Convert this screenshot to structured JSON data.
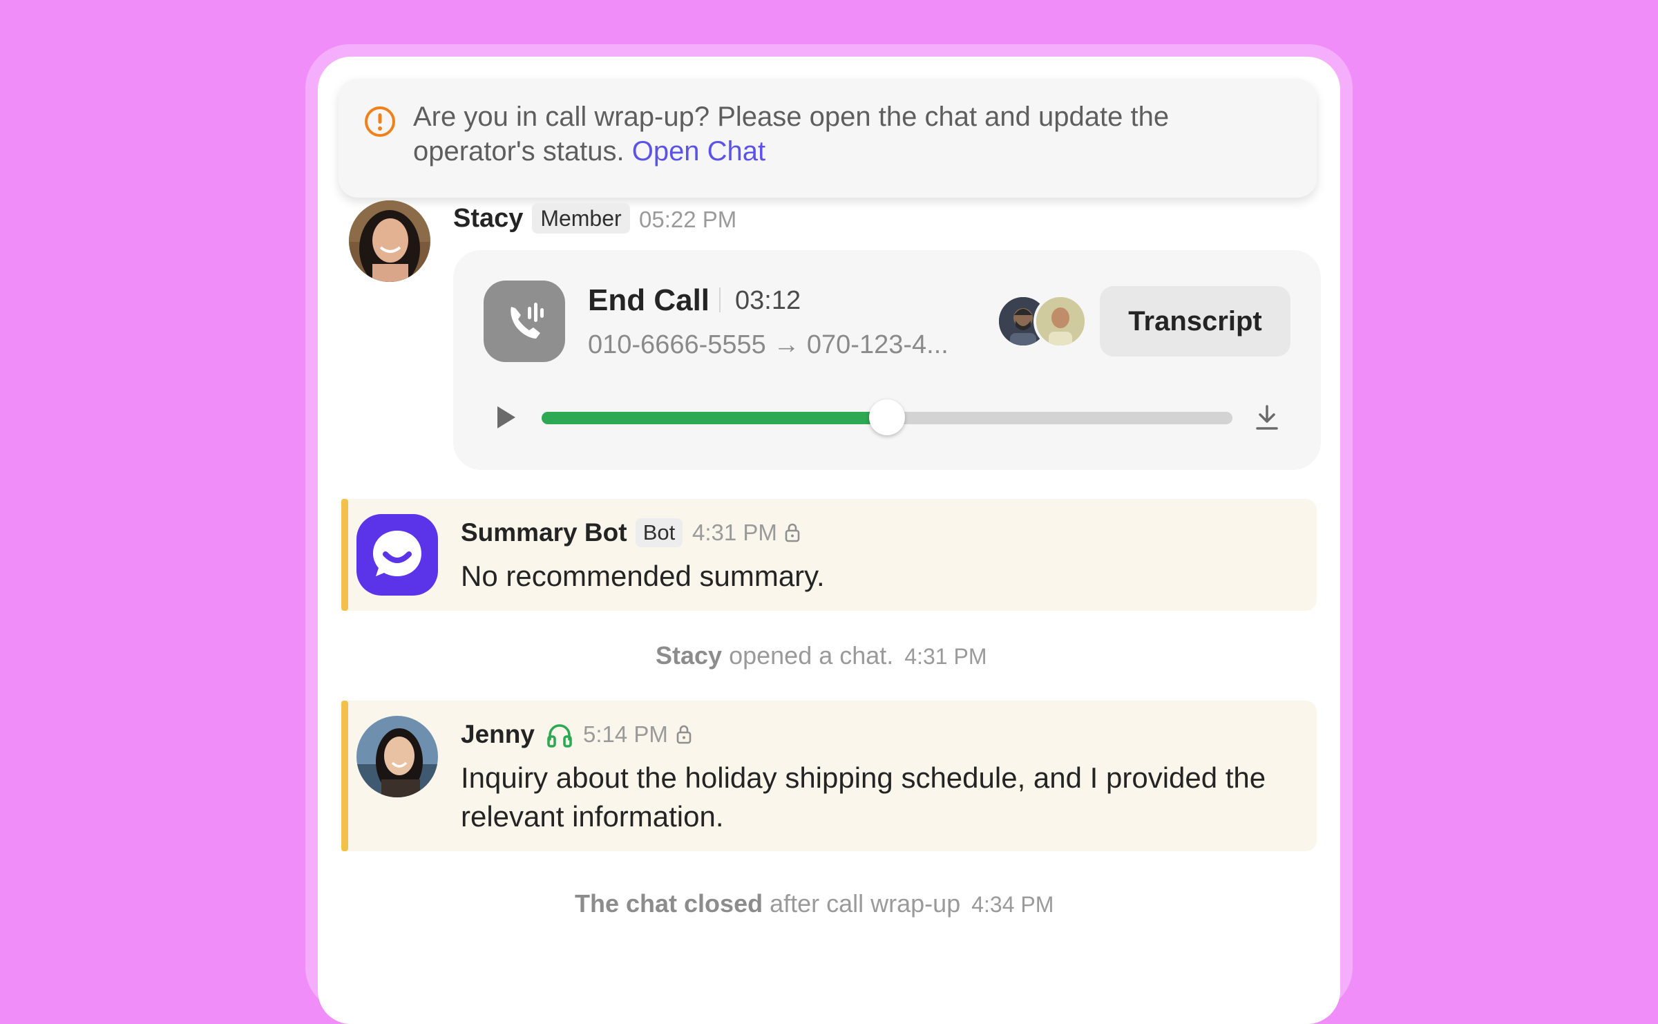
{
  "banner": {
    "text": "Are you in call wrap-up? Please open the chat and update the operator's status.",
    "link": "Open Chat",
    "icon": "alert-circle-icon",
    "icon_color": "#F08019"
  },
  "call_message": {
    "author": "Stacy",
    "role": "Member",
    "time": "05:22 PM",
    "card": {
      "title": "End Call",
      "duration": "03:12",
      "numbers": "010-6666-5555 → 070-123-4...",
      "transcript_label": "Transcript",
      "playback_progress": 0.5
    }
  },
  "summary_message": {
    "author": "Summary Bot",
    "role": "Bot",
    "time": "4:31 PM",
    "text": "No recommended summary."
  },
  "system_opened": {
    "actor": "Stacy",
    "action": "opened a chat.",
    "time": "4:31 PM"
  },
  "jenny_message": {
    "author": "Jenny",
    "time": "5:14 PM",
    "text": "Inquiry about the holiday shipping schedule, and I provided the relevant information."
  },
  "system_closed": {
    "actor": "The chat closed",
    "action": "after call wrap-up",
    "time": "4:34 PM"
  },
  "colors": {
    "background": "#F08DF8",
    "accent_link": "#5B53E8",
    "progress": "#2DA853",
    "highlight_bar": "#F2C14A",
    "bot_brand": "#5B34EA"
  }
}
